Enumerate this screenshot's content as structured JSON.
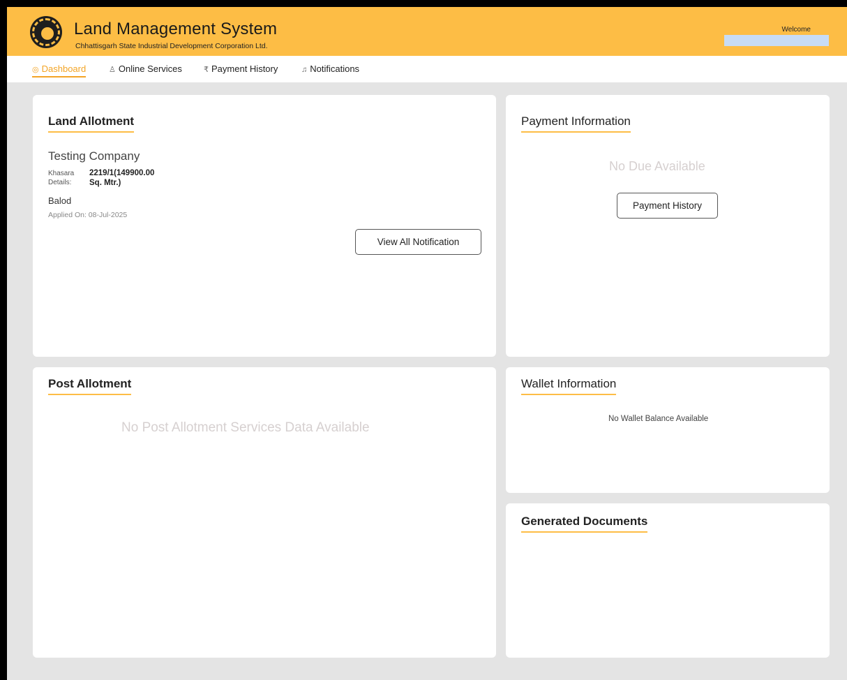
{
  "header": {
    "title": "Land Management System",
    "subtitle": "Chhattisgarh State Industrial Development Corporation Ltd.",
    "welcome": "Welcome"
  },
  "nav": {
    "items": [
      {
        "label": "Dashboard",
        "icon": "dashboard-icon"
      },
      {
        "label": "Online Services",
        "icon": "user-icon"
      },
      {
        "label": "Payment History",
        "icon": "rupee-icon"
      },
      {
        "label": "Notifications",
        "icon": "bell-icon"
      }
    ]
  },
  "land_allotment": {
    "title": "Land Allotment",
    "company": "Testing Company",
    "khasara_label_1": "Khasara",
    "khasara_label_2": "Details:",
    "khasara_value_1": "2219/1(149900.00",
    "khasara_value_2": "Sq. Mtr.)",
    "district": "Balod",
    "applied_on": "Applied On: 08-Jul-2025",
    "button": "View All Notification"
  },
  "payment_info": {
    "title": "Payment Information",
    "empty": "No Due Available",
    "button": "Payment History"
  },
  "post_allotment": {
    "title": "Post Allotment",
    "empty": "No Post Allotment Services Data Available"
  },
  "wallet_info": {
    "title": "Wallet Information",
    "empty": "No Wallet Balance Available"
  },
  "generated_docs": {
    "title": "Generated Documents"
  },
  "colors": {
    "accent": "#fdbd45",
    "active_nav": "#f3a425",
    "background": "#e4e4e4"
  }
}
